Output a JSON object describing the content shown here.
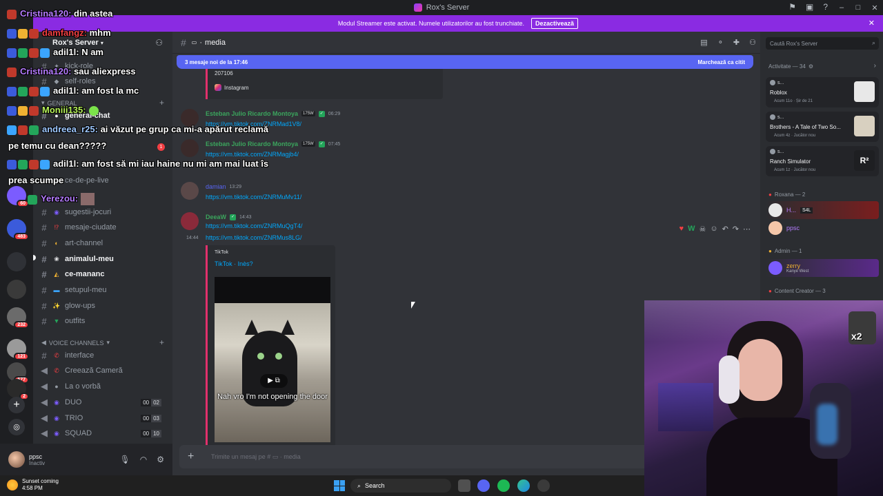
{
  "window": {
    "title": "Rox's Server"
  },
  "banner": {
    "text": "Modul Streamer este activat. Numele utilizatorilor au fost trunchiate.",
    "button": "Dezactivează"
  },
  "server": {
    "name": "Rox's Server",
    "badges": [
      "60",
      "483",
      "232",
      "121",
      "577",
      "2"
    ]
  },
  "channels": {
    "top": [
      {
        "icon": "bookmark",
        "name": "kick-role"
      },
      {
        "icon": "role",
        "name": "self-roles"
      }
    ],
    "general_category": "GENERAL",
    "general": [
      {
        "icon": "chat",
        "name": "general-chat"
      },
      {
        "icon": "live",
        "name": "ce-de-pe-live"
      },
      {
        "icon": "game",
        "name": "sugestii-jocuri"
      },
      {
        "icon": "question",
        "name": "mesaje-ciudate"
      },
      {
        "icon": "palette",
        "name": "art-channel"
      },
      {
        "icon": "pet",
        "name": "animalul-meu"
      },
      {
        "icon": "food",
        "name": "ce-mananc"
      },
      {
        "icon": "setup",
        "name": "setupul-meu"
      },
      {
        "icon": "sparkle",
        "name": "glow-ups"
      },
      {
        "icon": "shirt",
        "name": "outfits"
      }
    ],
    "voice_category": "VOICE CHANNELS",
    "voice": [
      {
        "icon": "phone",
        "name": "interface",
        "users": "",
        "limit": ""
      },
      {
        "icon": "phone",
        "name": "Creează Cameră",
        "users": "",
        "limit": ""
      },
      {
        "icon": "speech",
        "name": "La o vorbă",
        "users": "",
        "limit": ""
      },
      {
        "icon": "game",
        "name": "DUO",
        "users": "00",
        "limit": "02"
      },
      {
        "icon": "game",
        "name": "TRIO",
        "users": "00",
        "limit": "03"
      },
      {
        "icon": "game",
        "name": "SQUAD",
        "users": "00",
        "limit": "10"
      }
    ],
    "unread_badge": "1"
  },
  "user_panel": {
    "name": "ppsc",
    "status": "Inactiv"
  },
  "chat": {
    "channel": "media",
    "new_messages": "3 mesaje noi de la 17:46",
    "mark_read": "Marchează ca citit",
    "embed_top": {
      "text": "207106",
      "provider": "Instagram"
    },
    "messages": [
      {
        "author": "Esteban Julio Ricardo Montoya",
        "badge": "175W",
        "time": "06:29",
        "link": "https://vm.tiktok.com/ZNRMad1V8/",
        "color": "#3ba55d"
      },
      {
        "author": "Esteban Julio Ricardo Montoya",
        "badge": "175W",
        "time": "07:45",
        "link": "https://vm.tiktok.com/ZNRMagjb4/",
        "color": "#3ba55d"
      },
      {
        "author": "damian",
        "badge": "",
        "time": "13:29",
        "link": "https://vm.tiktok.com/ZNRMuMv11/",
        "color": "#5865f2"
      },
      {
        "author": "DeeaW",
        "badge": "",
        "time": "14:43",
        "link": "https://vm.tiktok.com/ZNRMuQgT4/",
        "color": "#3ba55d"
      }
    ],
    "followup": {
      "time": "14:44",
      "link": "https://vm.tiktok.com/ZNRMus8LG/"
    },
    "tiktok_embed": {
      "provider": "TikTok",
      "title": "TikTok · Inès?",
      "caption": "Nah vro I'm not opening the door"
    },
    "reactions": [
      "W"
    ],
    "composer_placeholder": "Trimite un mesaj pe #",
    "composer_channel": "media"
  },
  "right": {
    "search_placeholder": "Caută Rox's Server",
    "activity_title": "Activitate — 34",
    "activities": [
      {
        "user": "s...",
        "game": "Roblox",
        "sub": "Acum 11o · Șir de 21"
      },
      {
        "user": "s...",
        "game": "Brothers - A Tale of Two So...",
        "sub": "Acum 4z · Jucător nou"
      },
      {
        "user": "s...",
        "game": "Ranch Simulator",
        "sub": "Acum 1z · Jucător nou"
      }
    ],
    "roles": [
      {
        "title": "Roxana — 2",
        "members": [
          {
            "name": "H...",
            "tag": "S4L"
          },
          {
            "name": "ppsc",
            "tag": ""
          }
        ]
      },
      {
        "title": "Admin — 1",
        "members": [
          {
            "name": "zerry",
            "tag": "Kanye West"
          }
        ]
      },
      {
        "title": "Content Creator — 3",
        "members": []
      }
    ]
  },
  "overlay": [
    {
      "name": "Cristina120:",
      "text": " din astea"
    },
    {
      "name": "damfangz:",
      "text": " mhm"
    },
    {
      "name": "adil1l:",
      "text": " N am"
    },
    {
      "name": "Cristina120:",
      "text": " sau aliexpress"
    },
    {
      "name": "adil1l:",
      "text": " am fost la mc"
    },
    {
      "name": "Moniii135:",
      "text": ""
    },
    {
      "name": "andreea_r25:",
      "text": " ai văzut pe grup ca mi-a apărut reclamă"
    },
    {
      "name": "",
      "text": "pe temu cu dean?????"
    },
    {
      "name": "adil1l:",
      "text": " am fost să mi iau haine nu mi am mai luat îs"
    },
    {
      "name": "",
      "text": "prea scumpe"
    },
    {
      "name": "Yerezou:",
      "text": ""
    }
  ],
  "webcam": {
    "multiplier": "x2"
  },
  "taskbar": {
    "weather_title": "Sunset coming",
    "weather_time": "4:58 PM",
    "search": "Search"
  },
  "colors": {
    "accent": "#5865f2",
    "banner": "#8a2be2",
    "link": "#00a8fc"
  }
}
